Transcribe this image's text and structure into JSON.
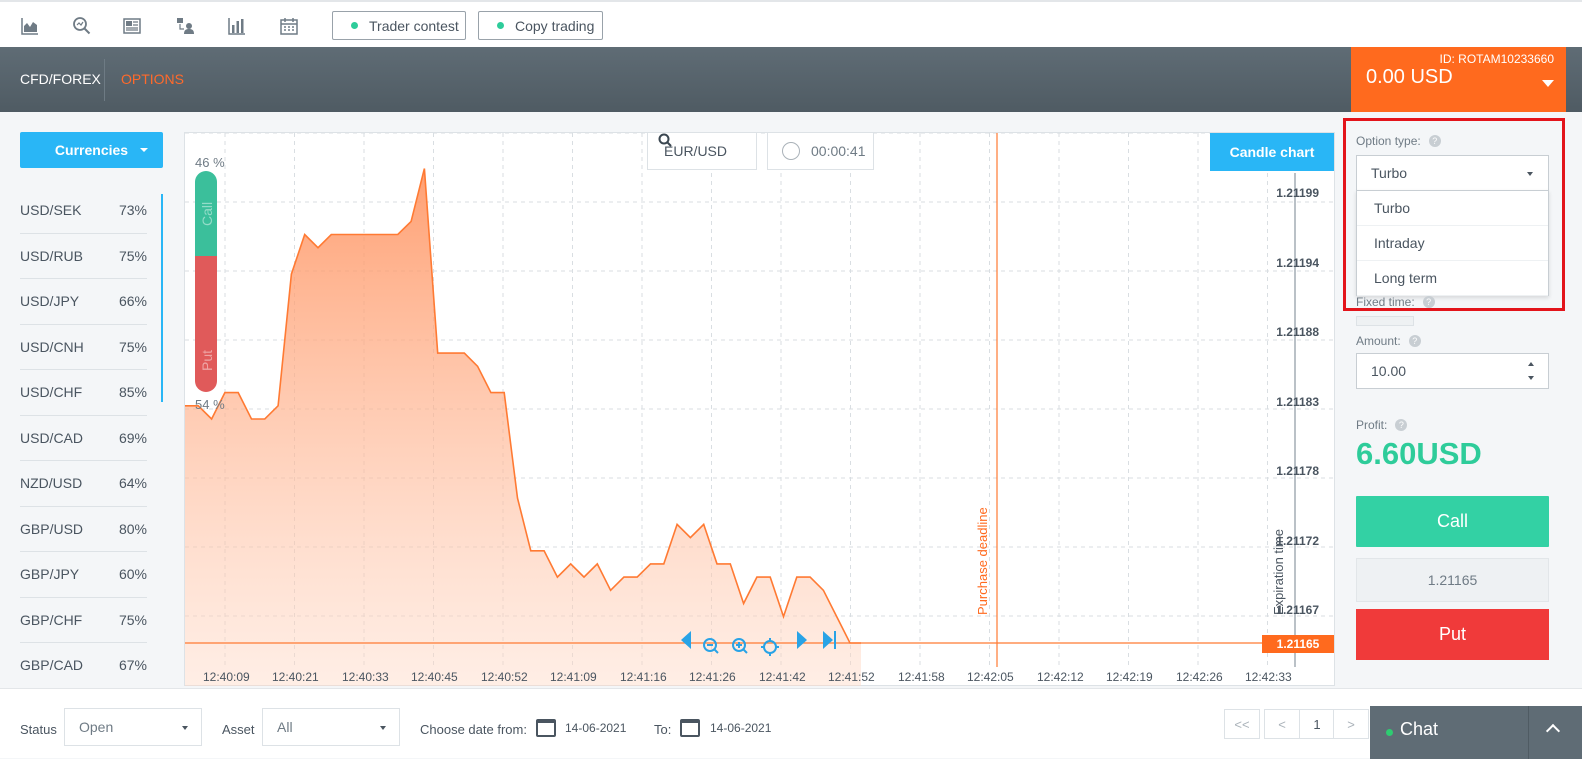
{
  "toolbar": {
    "icons": [
      "chart-area-icon",
      "analysis-search-icon",
      "news-icon",
      "users-network-icon",
      "bar-chart-icon",
      "calendar-icon"
    ],
    "trader_contest": "Trader contest",
    "copy_trading": "Copy trading"
  },
  "nav": {
    "cfd_forex": "CFD/FOREX",
    "options": "OPTIONS",
    "account_id": "ID: ROTAM10233660",
    "balance": "0.00 USD"
  },
  "sidebar": {
    "category_button": "Currencies",
    "assets": [
      {
        "name": "USD/SEK",
        "pct": "73%"
      },
      {
        "name": "USD/RUB",
        "pct": "75%"
      },
      {
        "name": "USD/JPY",
        "pct": "66%"
      },
      {
        "name": "USD/CNH",
        "pct": "75%"
      },
      {
        "name": "USD/CHF",
        "pct": "85%"
      },
      {
        "name": "USD/CAD",
        "pct": "69%"
      },
      {
        "name": "NZD/USD",
        "pct": "64%"
      },
      {
        "name": "GBP/USD",
        "pct": "80%"
      },
      {
        "name": "GBP/JPY",
        "pct": "60%"
      },
      {
        "name": "GBP/CHF",
        "pct": "75%"
      },
      {
        "name": "GBP/CAD",
        "pct": "67%"
      }
    ]
  },
  "chart": {
    "pair": "EUR/USD",
    "timer": "00:00:41",
    "candle_button": "Candle chart",
    "call_pct": "46 %",
    "put_pct": "54 %",
    "call_label": "Call",
    "put_label": "Put",
    "current_price": "1.21165",
    "purchase_deadline": "Purchase deadline",
    "expiration_time": "Expiration time",
    "y_ticks": [
      "1.21199",
      "1.21194",
      "1.21188",
      "1.21183",
      "1.21178",
      "1.21172",
      "1.21167"
    ],
    "x_ticks": [
      "12:40:09",
      "12:40:21",
      "12:40:33",
      "12:40:45",
      "12:40:52",
      "12:41:09",
      "12:41:16",
      "12:41:26",
      "12:41:42",
      "12:41:52",
      "12:41:58",
      "12:42:05",
      "12:42:12",
      "12:42:19",
      "12:42:26",
      "12:42:33"
    ],
    "line_color": "#ff7a33"
  },
  "chart_data": {
    "type": "area",
    "ylim": [
      1.21165,
      1.21199
    ],
    "x_start": "12:40:09",
    "x_end": "12:41:52",
    "values": [
      1.21183,
      1.21183,
      1.21182,
      1.21184,
      1.21184,
      1.21182,
      1.21182,
      1.21183,
      1.21193,
      1.21196,
      1.21195,
      1.21196,
      1.21196,
      1.21196,
      1.21196,
      1.21196,
      1.21196,
      1.21197,
      1.21201,
      1.21187,
      1.21187,
      1.21187,
      1.21186,
      1.21184,
      1.21184,
      1.21176,
      1.21172,
      1.21172,
      1.2117,
      1.21171,
      1.2117,
      1.21171,
      1.21169,
      1.2117,
      1.2117,
      1.21171,
      1.21171,
      1.21174,
      1.21173,
      1.21174,
      1.21171,
      1.21171,
      1.21168,
      1.2117,
      1.2117,
      1.21167,
      1.2117,
      1.2117,
      1.21169,
      1.21167,
      1.21165
    ]
  },
  "order_panel": {
    "option_type_label": "Option type:",
    "option_type_value": "Turbo",
    "option_type_options": [
      "Turbo",
      "Intraday",
      "Long term"
    ],
    "fixed_time_label": "Fixed time:",
    "amount_label": "Amount:",
    "amount_value": "10.00",
    "profit_label": "Profit:",
    "profit_value": "6.60USD",
    "call_button": "Call",
    "current_price": "1.21165",
    "put_button": "Put"
  },
  "bottom": {
    "status_label": "Status",
    "status_value": "Open",
    "asset_label": "Asset",
    "asset_value": "All",
    "date_from_label": "Choose date from:",
    "date_from": "14-06-2021",
    "to_label": "To:",
    "date_to": "14-06-2021",
    "pager": [
      "<<",
      "<",
      "1",
      ">"
    ],
    "chat": "Chat"
  },
  "colors": {
    "accent_blue": "#29b6f6",
    "orange": "#ff6a1e",
    "green": "#33d1a4",
    "red": "#f03a3a",
    "highlight": "#e3141b"
  }
}
